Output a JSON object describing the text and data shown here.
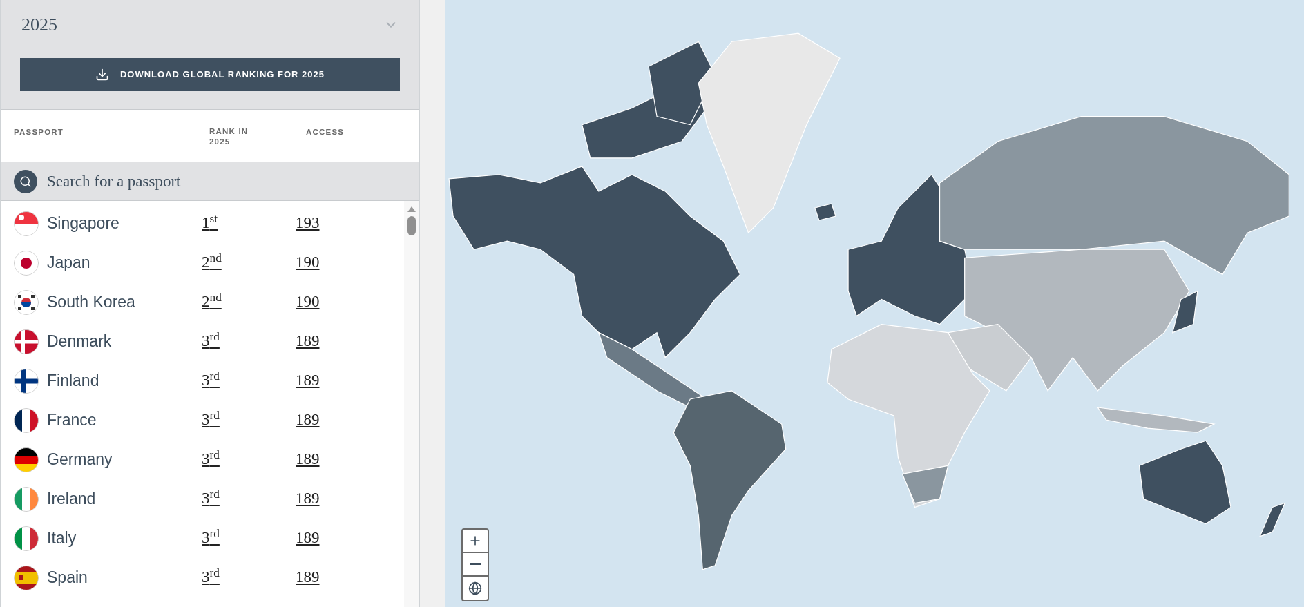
{
  "year_select": {
    "value": "2025"
  },
  "download_button": {
    "label": "DOWNLOAD GLOBAL RANKING FOR 2025"
  },
  "table": {
    "columns": [
      "PASSPORT",
      "RANK IN 2025",
      "ACCESS"
    ],
    "search": {
      "placeholder": "Search for a passport"
    },
    "rows": [
      {
        "passport": "Singapore",
        "rank": "1$^{st}$",
        "access": "193"
      },
      {
        "passport": "Japan",
        "rank": "2$^{nd}$",
        "access": "190"
      },
      {
        "passport": "South Korea",
        "rank": "2$^{nd}$",
        "access": "190"
      },
      {
        "passport": "Denmark",
        "rank": "3$^{rd}$",
        "access": "189"
      },
      {
        "passport": "Finland",
        "rank": "3$^{rd}$",
        "access": "189"
      },
      {
        "passport": "France",
        "rank": "3$^{rd}$",
        "access": "189"
      },
      {
        "passport": "Germany",
        "rank": "3$^{rd}$",
        "access": "189"
      },
      {
        "passport": "Ireland",
        "rank": "3$^{rd}$",
        "access": "189"
      },
      {
        "passport": "Italy",
        "rank": "3$^{rd}$",
        "access": "189"
      },
      {
        "passport": "Spain",
        "rank": "3$^{rd}$",
        "access": "189"
      }
    ]
  }
}
